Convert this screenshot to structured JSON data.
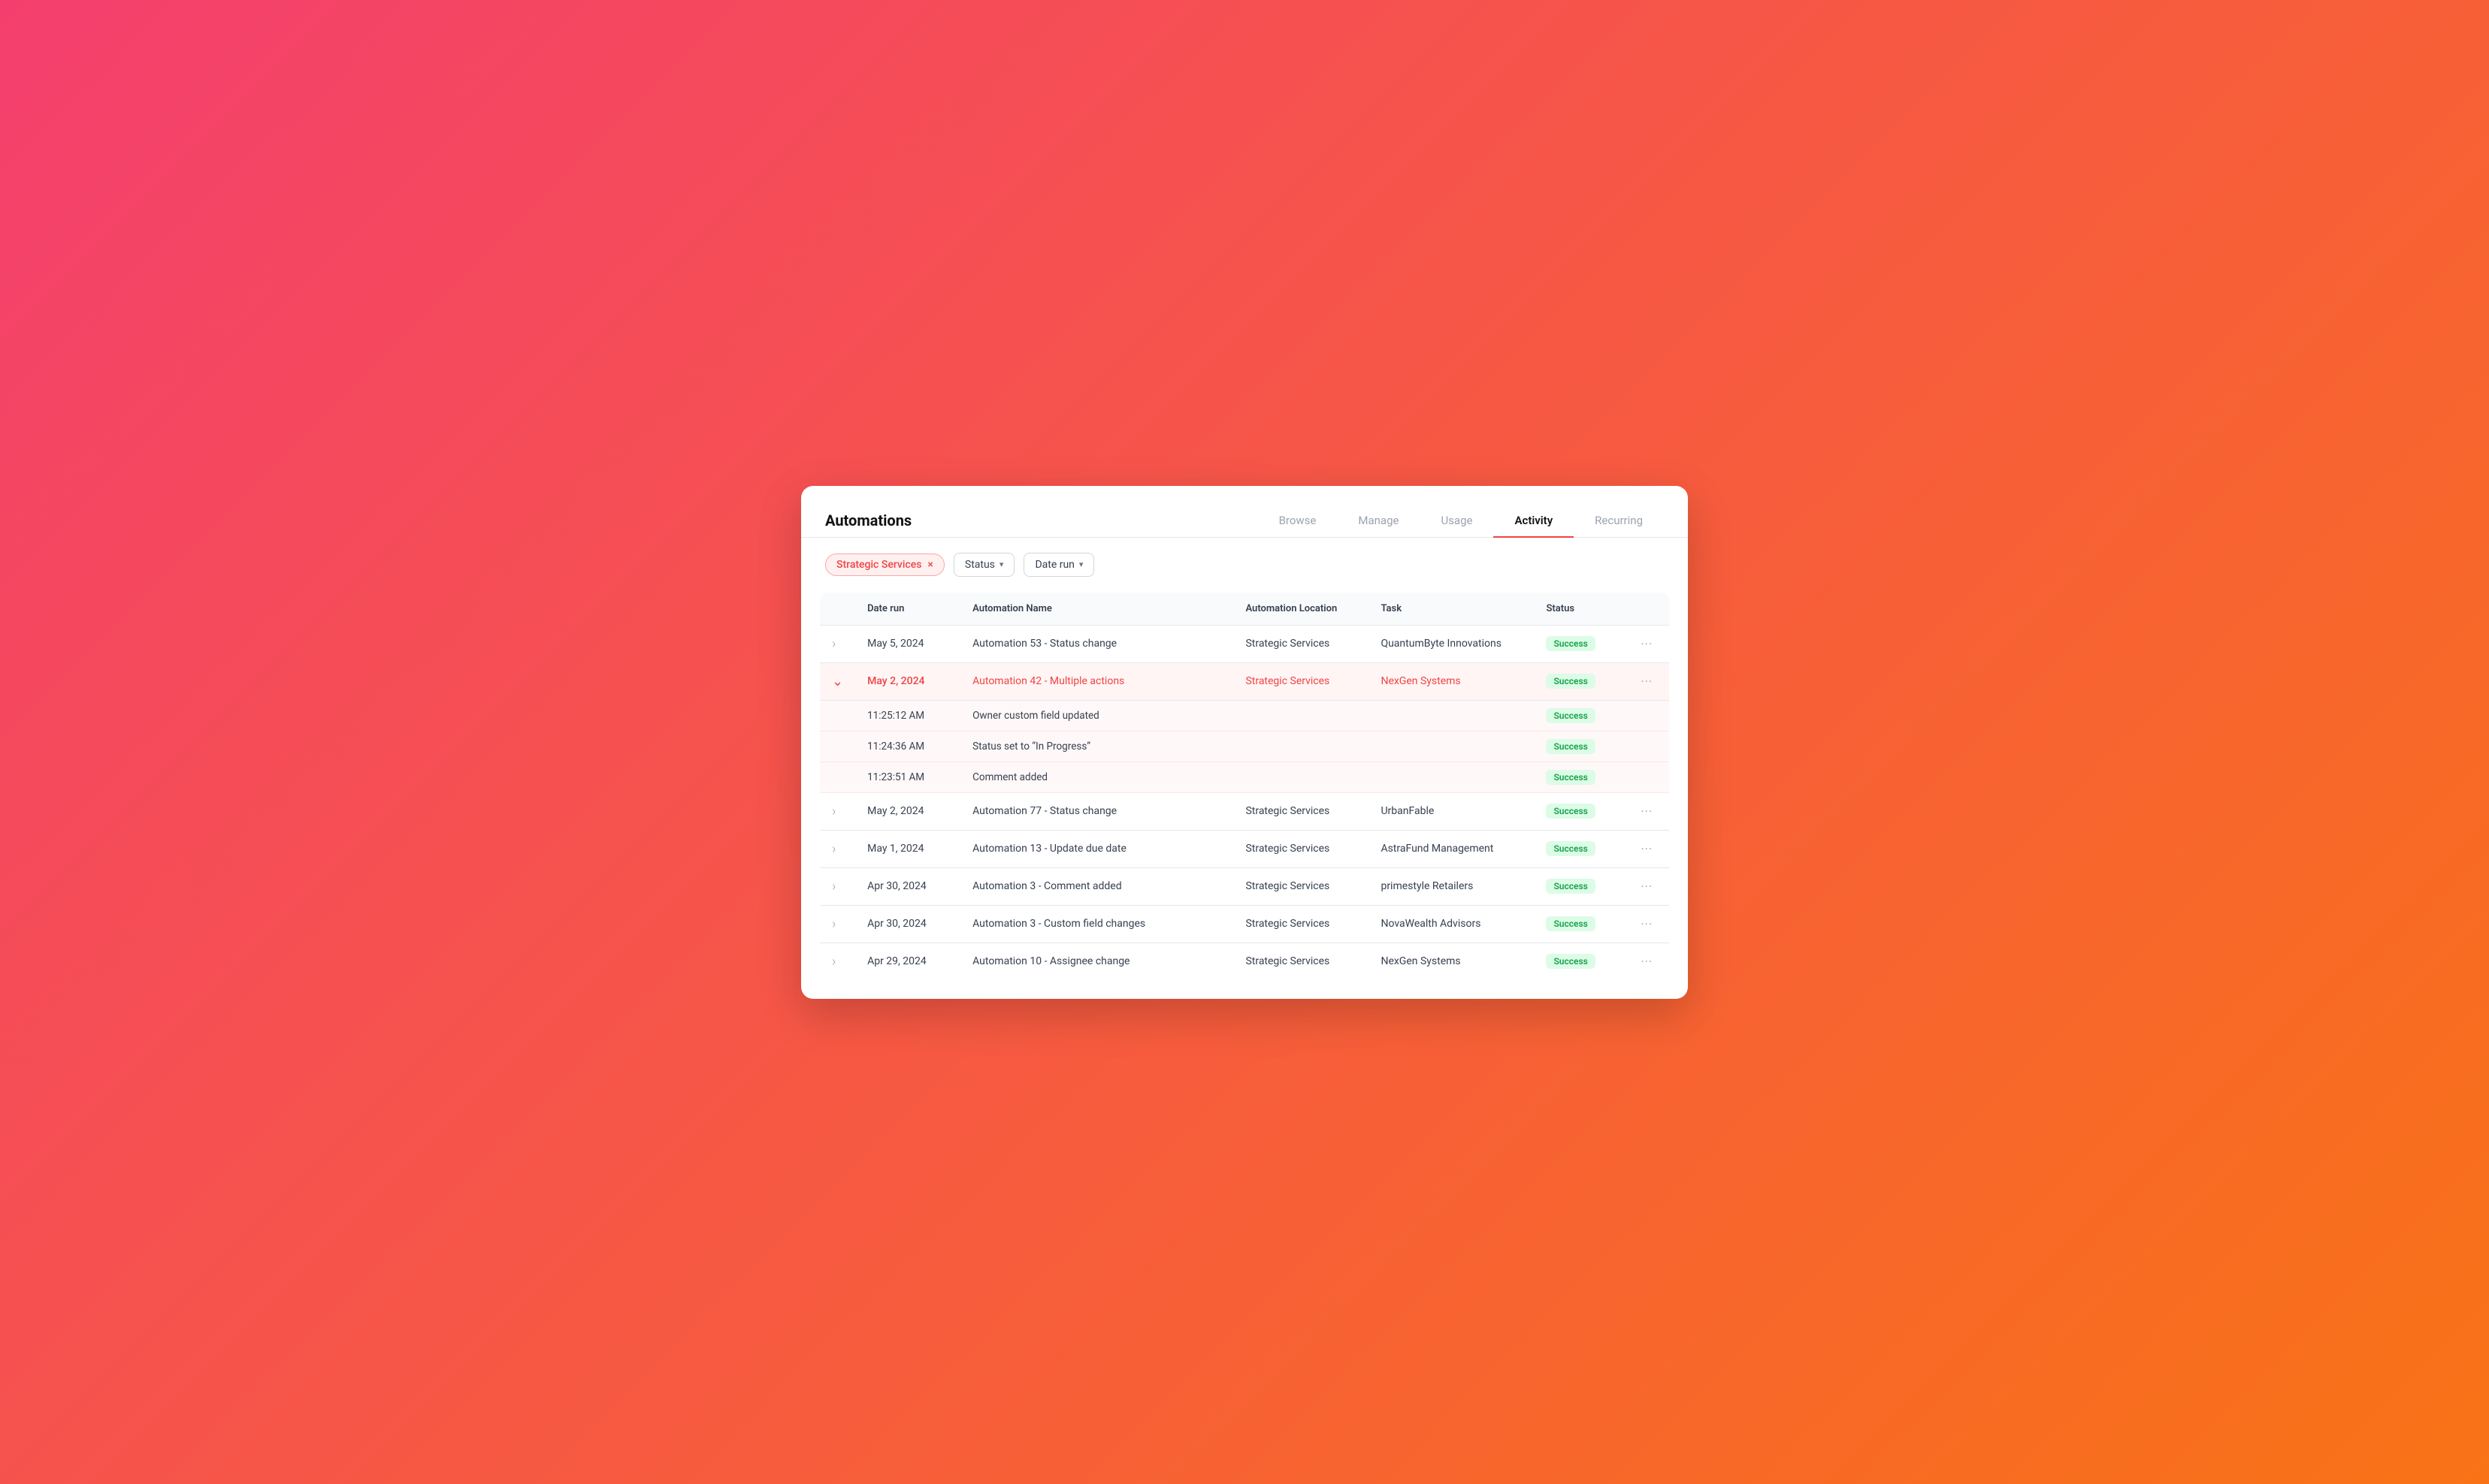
{
  "app": {
    "title": "Automations"
  },
  "nav": {
    "tabs": [
      {
        "id": "browse",
        "label": "Browse",
        "active": false
      },
      {
        "id": "manage",
        "label": "Manage",
        "active": false
      },
      {
        "id": "usage",
        "label": "Usage",
        "active": false
      },
      {
        "id": "activity",
        "label": "Activity",
        "active": true
      },
      {
        "id": "recurring",
        "label": "Recurring",
        "active": false
      }
    ]
  },
  "filters": {
    "tag": {
      "label": "Strategic Services",
      "close": "×"
    },
    "dropdowns": [
      {
        "id": "status",
        "label": "Status"
      },
      {
        "id": "daterun",
        "label": "Date run"
      }
    ]
  },
  "table": {
    "columns": [
      "Date run",
      "Automation Name",
      "Automation Location",
      "Task",
      "Status"
    ],
    "rows": [
      {
        "id": "row1",
        "expanded": false,
        "highlighted": false,
        "date": "May 5, 2024",
        "name": "Automation 53 - Status change",
        "location": "Strategic Services",
        "task": "QuantumByte Innovations",
        "status": "Success",
        "subrows": []
      },
      {
        "id": "row2",
        "expanded": true,
        "highlighted": true,
        "date": "May 2, 2024",
        "name": "Automation 42 - Multiple actions",
        "location": "Strategic Services",
        "task": "NexGen Systems",
        "status": "Success",
        "subrows": [
          {
            "time": "11:25:12 AM",
            "action": "Owner custom field updated",
            "status": "Success"
          },
          {
            "time": "11:24:36 AM",
            "action": "Status set to “In Progress”",
            "status": "Success"
          },
          {
            "time": "11:23:51 AM",
            "action": "Comment added",
            "status": "Success"
          }
        ]
      },
      {
        "id": "row3",
        "expanded": false,
        "highlighted": false,
        "date": "May 2, 2024",
        "name": "Automation 77 - Status change",
        "location": "Strategic Services",
        "task": "UrbanFable",
        "status": "Success",
        "subrows": []
      },
      {
        "id": "row4",
        "expanded": false,
        "highlighted": false,
        "date": "May 1, 2024",
        "name": "Automation 13 - Update due date",
        "location": "Strategic Services",
        "task": "AstraFund Management",
        "status": "Success",
        "subrows": []
      },
      {
        "id": "row5",
        "expanded": false,
        "highlighted": false,
        "date": "Apr 30, 2024",
        "name": "Automation 3 - Comment added",
        "location": "Strategic Services",
        "task": "primestyle Retailers",
        "status": "Success",
        "subrows": []
      },
      {
        "id": "row6",
        "expanded": false,
        "highlighted": false,
        "date": "Apr 30, 2024",
        "name": "Automation 3 - Custom field changes",
        "location": "Strategic Services",
        "task": "NovaWealth Advisors",
        "status": "Success",
        "subrows": []
      },
      {
        "id": "row7",
        "expanded": false,
        "highlighted": false,
        "date": "Apr 29, 2024",
        "name": "Automation 10 - Assignee change",
        "location": "Strategic Services",
        "task": "NexGen Systems",
        "status": "Success",
        "subrows": []
      }
    ]
  }
}
